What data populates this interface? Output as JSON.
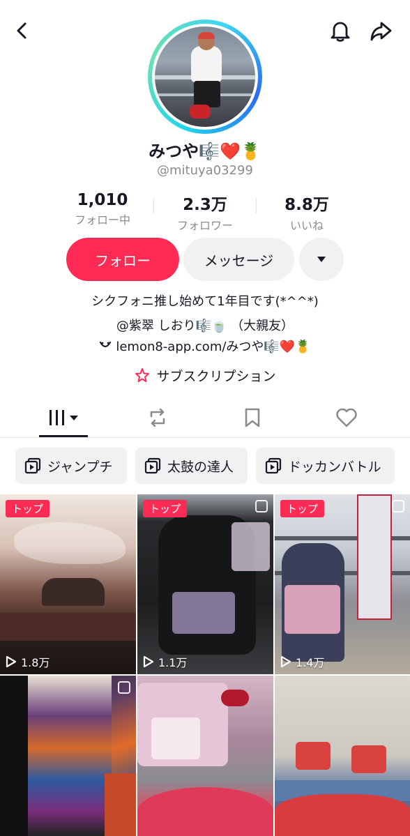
{
  "profile": {
    "name": "みつや🎼❤️🍍",
    "handle": "@mituya03299"
  },
  "stats": [
    {
      "value": "1,010",
      "label": "フォロー中"
    },
    {
      "value": "2.3万",
      "label": "フォロワー"
    },
    {
      "value": "8.8万",
      "label": "いいね"
    }
  ],
  "actions": {
    "follow": "フォロー",
    "message": "メッセージ"
  },
  "bio": {
    "line1": "シクフォニ推し始めて1年目です(*^^*)",
    "line2": "@紫翠  しおり🎼🍵  （大親友）",
    "link": "lemon8-app.com/みつや🎼❤️🍍",
    "subscription": "サブスクリプション"
  },
  "playlists": [
    "ジャンプチ",
    "太鼓の達人",
    "ドッカンバトル"
  ],
  "videos": [
    {
      "badge": "トップ",
      "plays": "1.8万"
    },
    {
      "badge": "トップ",
      "plays": "1.1万"
    },
    {
      "badge": "トップ",
      "plays": "1.4万"
    },
    {
      "badge": "",
      "plays": ""
    },
    {
      "badge": "",
      "plays": ""
    },
    {
      "badge": "",
      "plays": ""
    }
  ],
  "colors": {
    "accent": "#fe2c55",
    "secondary_button": "#f1f1f2",
    "muted_text": "#8a8b91"
  },
  "icons": {
    "back": "chevron-left-icon",
    "bell": "bell-icon",
    "share": "share-arrow-icon",
    "grid_tab": "grid-icon",
    "repost_tab": "repost-icon",
    "saved_tab": "bookmark-icon",
    "liked_tab": "heart-icon",
    "playlist": "playlist-icon",
    "play": "play-icon",
    "link": "link-icon",
    "subscription": "subscription-icon"
  }
}
